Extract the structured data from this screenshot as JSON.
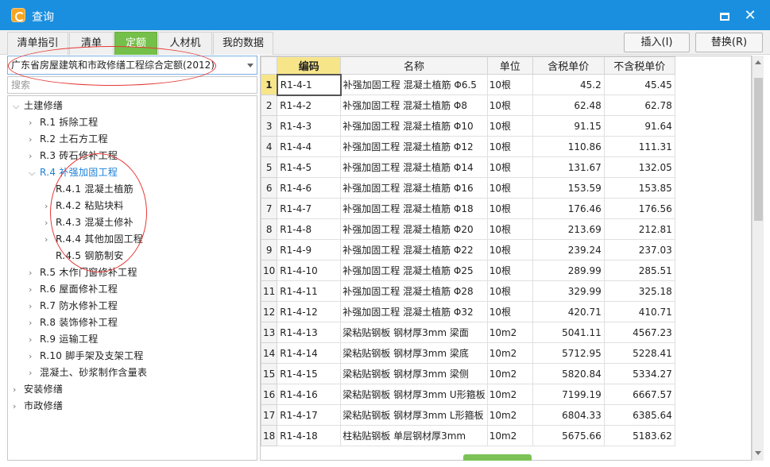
{
  "window": {
    "title": "查询"
  },
  "tabs": [
    {
      "label": "清单指引",
      "active": false
    },
    {
      "label": "清单",
      "active": false
    },
    {
      "label": "定额",
      "active": true
    },
    {
      "label": "人材机",
      "active": false
    },
    {
      "label": "我的数据",
      "active": false
    }
  ],
  "actions": {
    "insert": "插入(I)",
    "replace": "替换(R)"
  },
  "left": {
    "quota_library": "广东省房屋建筑和市政修缮工程综合定额(2012)",
    "search_placeholder": "搜索"
  },
  "tree": [
    {
      "label": "土建修缮",
      "state": "expanded",
      "level": 0
    },
    {
      "label": "R.1 拆除工程",
      "state": "collapsed",
      "level": 1
    },
    {
      "label": "R.2 土石方工程",
      "state": "collapsed",
      "level": 1
    },
    {
      "label": "R.3 砖石修补工程",
      "state": "collapsed",
      "level": 1
    },
    {
      "label": "R.4 补强加固工程",
      "state": "expanded",
      "level": 1,
      "selected": true
    },
    {
      "label": "R.4.1 混凝土植筋",
      "state": "leaf",
      "level": 2
    },
    {
      "label": "R.4.2 粘贴块料",
      "state": "collapsed",
      "level": 2
    },
    {
      "label": "R.4.3 混凝土修补",
      "state": "collapsed",
      "level": 2
    },
    {
      "label": "R.4.4 其他加固工程",
      "state": "collapsed",
      "level": 2
    },
    {
      "label": "R.4.5 钢筋制安",
      "state": "leaf",
      "level": 2
    },
    {
      "label": "R.5 木作门窗修补工程",
      "state": "collapsed",
      "level": 1
    },
    {
      "label": "R.6 屋面修补工程",
      "state": "collapsed",
      "level": 1
    },
    {
      "label": "R.7 防水修补工程",
      "state": "collapsed",
      "level": 1
    },
    {
      "label": "R.8 装饰修补工程",
      "state": "collapsed",
      "level": 1
    },
    {
      "label": "R.9 运输工程",
      "state": "collapsed",
      "level": 1
    },
    {
      "label": "R.10 脚手架及支架工程",
      "state": "collapsed",
      "level": 1
    },
    {
      "label": "混凝土、砂浆制作含量表",
      "state": "collapsed",
      "level": 1
    },
    {
      "label": "安装修缮",
      "state": "collapsed",
      "level": 0
    },
    {
      "label": "市政修缮",
      "state": "collapsed",
      "level": 0
    }
  ],
  "table": {
    "columns": [
      "编码",
      "名称",
      "单位",
      "含税单价",
      "不含税单价"
    ],
    "rows": [
      {
        "n": "1",
        "code": "R1-4-1",
        "name": "补强加固工程 混凝土植筋 Φ6.5",
        "unit": "10根",
        "tax": "45.2",
        "notax": "45.45"
      },
      {
        "n": "2",
        "code": "R1-4-2",
        "name": "补强加固工程 混凝土植筋 Φ8",
        "unit": "10根",
        "tax": "62.48",
        "notax": "62.78"
      },
      {
        "n": "3",
        "code": "R1-4-3",
        "name": "补强加固工程 混凝土植筋 Φ10",
        "unit": "10根",
        "tax": "91.15",
        "notax": "91.64"
      },
      {
        "n": "4",
        "code": "R1-4-4",
        "name": "补强加固工程 混凝土植筋 Φ12",
        "unit": "10根",
        "tax": "110.86",
        "notax": "111.31"
      },
      {
        "n": "5",
        "code": "R1-4-5",
        "name": "补强加固工程 混凝土植筋 Φ14",
        "unit": "10根",
        "tax": "131.67",
        "notax": "132.05"
      },
      {
        "n": "6",
        "code": "R1-4-6",
        "name": "补强加固工程 混凝土植筋 Φ16",
        "unit": "10根",
        "tax": "153.59",
        "notax": "153.85"
      },
      {
        "n": "7",
        "code": "R1-4-7",
        "name": "补强加固工程 混凝土植筋 Φ18",
        "unit": "10根",
        "tax": "176.46",
        "notax": "176.56"
      },
      {
        "n": "8",
        "code": "R1-4-8",
        "name": "补强加固工程 混凝土植筋 Φ20",
        "unit": "10根",
        "tax": "213.69",
        "notax": "212.81"
      },
      {
        "n": "9",
        "code": "R1-4-9",
        "name": "补强加固工程 混凝土植筋 Φ22",
        "unit": "10根",
        "tax": "239.24",
        "notax": "237.03"
      },
      {
        "n": "10",
        "code": "R1-4-10",
        "name": "补强加固工程 混凝土植筋 Φ25",
        "unit": "10根",
        "tax": "289.99",
        "notax": "285.51"
      },
      {
        "n": "11",
        "code": "R1-4-11",
        "name": "补强加固工程 混凝土植筋 Φ28",
        "unit": "10根",
        "tax": "329.99",
        "notax": "325.18"
      },
      {
        "n": "12",
        "code": "R1-4-12",
        "name": "补强加固工程 混凝土植筋 Φ32",
        "unit": "10根",
        "tax": "420.71",
        "notax": "410.71"
      },
      {
        "n": "13",
        "code": "R1-4-13",
        "name": "梁粘贴钢板 钢材厚3mm 梁面",
        "unit": "10m2",
        "tax": "5041.11",
        "notax": "4567.23"
      },
      {
        "n": "14",
        "code": "R1-4-14",
        "name": "梁粘贴钢板 钢材厚3mm 梁底",
        "unit": "10m2",
        "tax": "5712.95",
        "notax": "5228.41"
      },
      {
        "n": "15",
        "code": "R1-4-15",
        "name": "梁粘贴钢板 钢材厚3mm 梁侧",
        "unit": "10m2",
        "tax": "5820.84",
        "notax": "5334.27"
      },
      {
        "n": "16",
        "code": "R1-4-16",
        "name": "梁粘贴钢板 钢材厚3mm U形箍板",
        "unit": "10m2",
        "tax": "7199.19",
        "notax": "6667.57"
      },
      {
        "n": "17",
        "code": "R1-4-17",
        "name": "梁粘贴钢板 钢材厚3mm L形箍板",
        "unit": "10m2",
        "tax": "6804.33",
        "notax": "6385.64"
      },
      {
        "n": "18",
        "code": "R1-4-18",
        "name": "柱粘贴钢板 单层钢材厚3mm",
        "unit": "10m2",
        "tax": "5675.66",
        "notax": "5183.62"
      }
    ]
  }
}
